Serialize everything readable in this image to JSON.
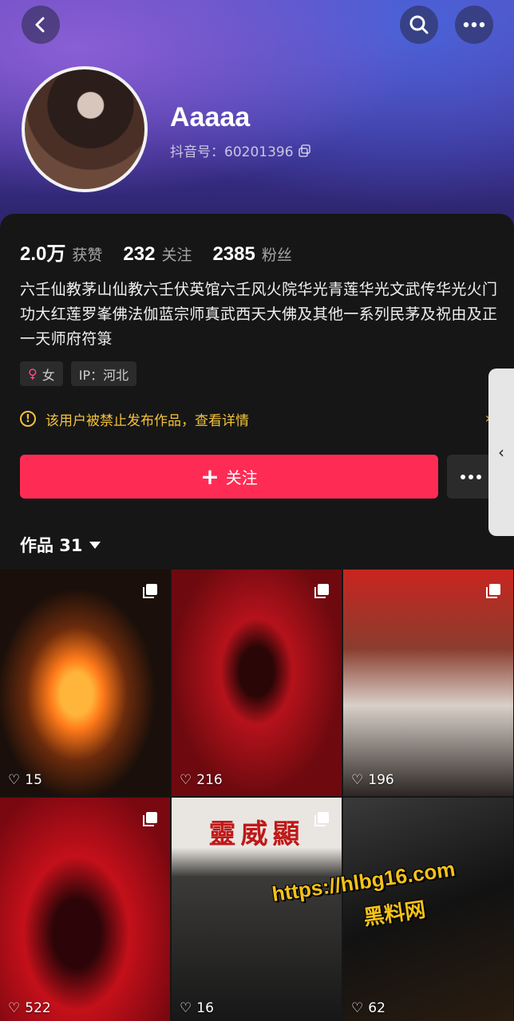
{
  "profile": {
    "username": "Aaaaa",
    "douyin_id": "抖音号：60201396",
    "stats": [
      {
        "value": "2.0万",
        "label": "获赞"
      },
      {
        "value": "232",
        "label": "关注"
      },
      {
        "value": "2385",
        "label": "粉丝"
      }
    ],
    "bio": "六壬仙教茅山仙教六壬伏英馆六壬风火院华光青莲华光文武传华光火门功大红莲罗峯佛法伽蓝宗师真武西天大佛及其他一系列民茅及祝由及正一天师府符箓",
    "tags": {
      "gender": "女",
      "ip": "IP：河北"
    },
    "notice": "该用户被禁止发布作品，查看详情"
  },
  "actions": {
    "follow_label": "关注"
  },
  "works": {
    "tab_label": "作品 31",
    "items": [
      {
        "likes": "15"
      },
      {
        "likes": "216"
      },
      {
        "likes": "196"
      },
      {
        "likes": "522"
      },
      {
        "likes": "16",
        "banner": "靈威顯"
      },
      {
        "likes": "62"
      }
    ]
  },
  "watermark": {
    "url": "https://hlbg16.com",
    "name": "黑料网"
  },
  "colors": {
    "accent": "#fe2c55",
    "warning": "#f3c23a",
    "background": "#161616"
  }
}
